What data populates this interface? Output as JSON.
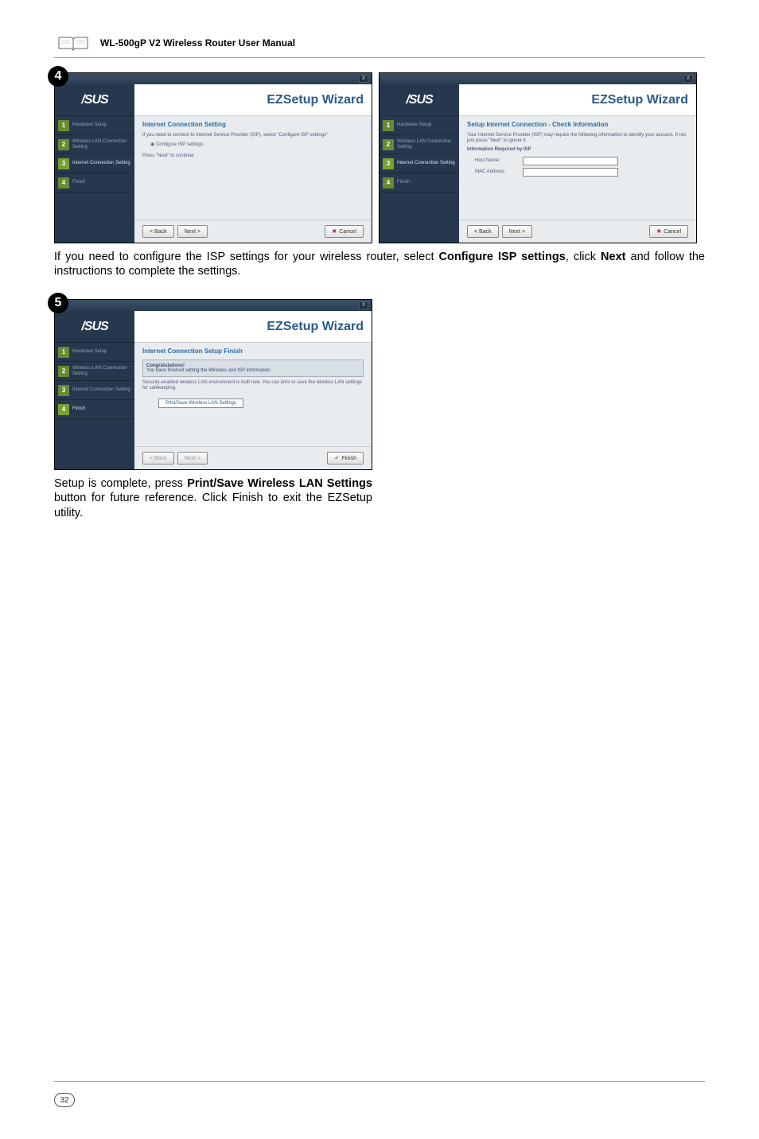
{
  "header": {
    "manual_title": "WL-500gP V2 Wireless Router User Manual"
  },
  "badges": {
    "step4": "4",
    "step5": "5"
  },
  "common": {
    "logo": "/SUS",
    "wizard_title": "EZSetup Wizard",
    "close_x": "X"
  },
  "sidebar": {
    "items": [
      {
        "num": "1",
        "label": "Hardware Setup"
      },
      {
        "num": "2",
        "label": "Wireless LAN Connection Setting"
      },
      {
        "num": "3",
        "label": "Internet Connection Setting"
      },
      {
        "num": "4",
        "label": "Finish"
      }
    ]
  },
  "screen4a": {
    "title": "Internet Connection Setting",
    "desc": "If you need to connect to Internet Service Provider (ISP), select \"Configure ISP settings\"",
    "radio": "Configure ISP settings",
    "press": "Press \"Next\" to continue",
    "btn_back": "< Back",
    "btn_next": "Next >",
    "btn_cancel": "Cancel"
  },
  "screen4b": {
    "title": "Setup Internet Connection - Check Information",
    "desc": "Your Internet Service Provider (ISP) may require the following information to identify your account. If not, just press \"Next\" to ignore it.",
    "info_label": "Information Required by ISP",
    "host_label": "Host Name:",
    "mac_label": "MAC Address:",
    "btn_back": "< Back",
    "btn_next": "Next >",
    "btn_cancel": "Cancel"
  },
  "caption4": {
    "pre": "If you need to configure the ISP settings for your wireless router, select ",
    "b1": "Configure ISP settings",
    "mid": ", click ",
    "b2": "Next",
    "post": " and follow the instructions to complete the settings."
  },
  "screen5": {
    "title": "Internet Connection Setup Finish",
    "congrat_h": "Congratulations!",
    "congrat_t": "You have finished setting the Wireless and ISP information.",
    "sec": "Security-enabled wireless LAN environment is built now. You can print or save the wireless LAN settings for safekeeping.",
    "print_btn": "Print/Save Wireless LAN Settings",
    "btn_back": "< Back",
    "btn_next": "Next >",
    "btn_finish": "Finish"
  },
  "caption5": {
    "pre": "Setup is complete, press ",
    "b1": "Print/Save Wireless LAN Settings",
    "post": " button for future reference. Click Finish to exit the EZSetup utility."
  },
  "page_number": "32"
}
